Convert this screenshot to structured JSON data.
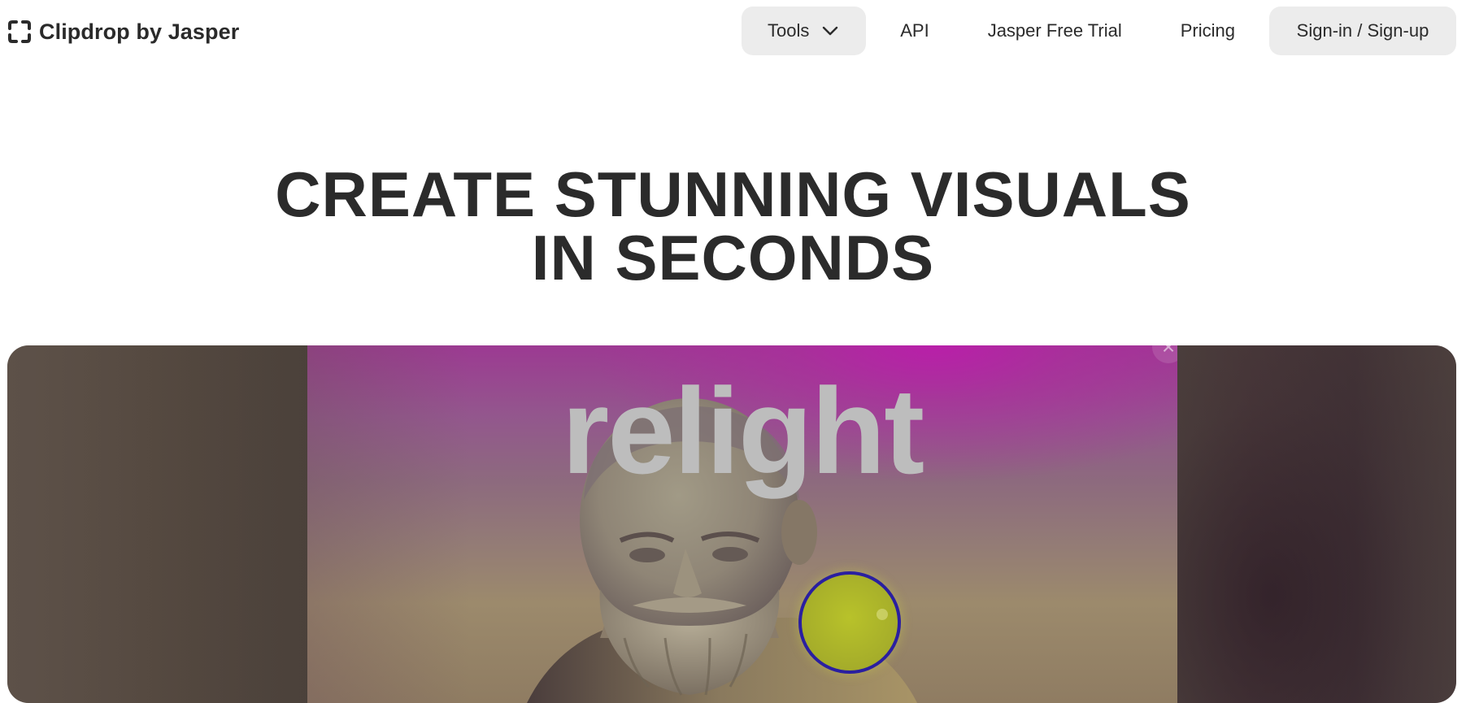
{
  "brand": {
    "name": "Clipdrop by Jasper",
    "logo_icon": "clipdrop-bracket-icon"
  },
  "nav": {
    "tools_label": "Tools",
    "tools_icon": "chevron-down-icon",
    "api_label": "API",
    "trial_label": "Jasper Free Trial",
    "pricing_label": "Pricing",
    "signin_label": "Sign-in / Sign-up"
  },
  "hero": {
    "title_line1": "CREATE STUNNING VISUALS",
    "title_line2": "IN SECONDS"
  },
  "demo": {
    "tool_word": "relight",
    "close_glyph": "×",
    "light_color": "#b8c22a",
    "light_ring_color": "#2a1fa0",
    "background_accent": "#b21fa0"
  }
}
